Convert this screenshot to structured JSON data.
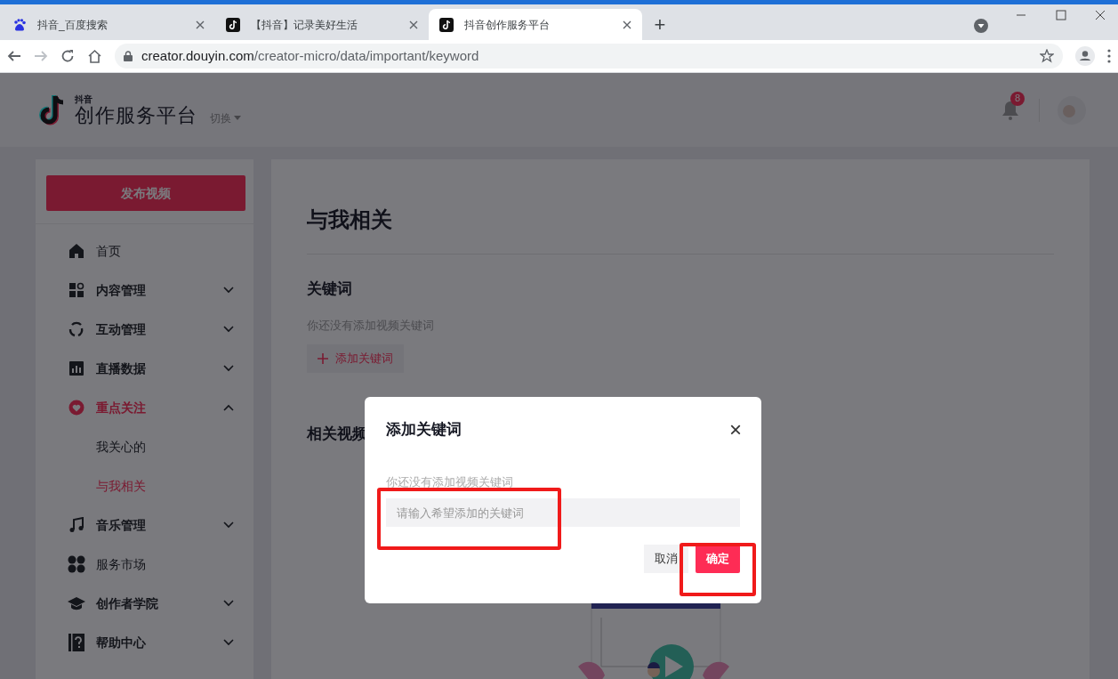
{
  "browser": {
    "tabs": [
      {
        "kind": "baidu",
        "title": "抖音_百度搜索",
        "selected": false
      },
      {
        "kind": "douyin",
        "title": "【抖音】记录美好生活",
        "selected": false
      },
      {
        "kind": "douyin",
        "title": "抖音创作服务平台",
        "selected": true
      }
    ],
    "new_tab": "+",
    "url_host": "creator.douyin.com",
    "url_path": "/creator-micro/data/important/keyword"
  },
  "header": {
    "logo_small": "抖音",
    "logo_title": "创作服务平台",
    "switch": "切换",
    "notification_count": "8"
  },
  "sidebar": {
    "publish_button": "发布视频",
    "items": [
      {
        "kind": "link",
        "label": "首页",
        "selected": false
      },
      {
        "kind": "group",
        "label": "内容管理",
        "selected": false,
        "expanded": false
      },
      {
        "kind": "group",
        "label": "互动管理",
        "selected": false,
        "expanded": false
      },
      {
        "kind": "group",
        "label": "直播数据",
        "selected": false,
        "expanded": false
      },
      {
        "kind": "group",
        "label": "重点关注",
        "selected": true,
        "expanded": true,
        "children": [
          {
            "label": "我关心的",
            "selected": false
          },
          {
            "label": "与我相关",
            "selected": true
          }
        ]
      },
      {
        "kind": "group",
        "label": "音乐管理",
        "selected": false,
        "expanded": false
      },
      {
        "kind": "link",
        "label": "服务市场",
        "selected": false
      },
      {
        "kind": "group",
        "label": "创作者学院",
        "selected": false,
        "expanded": false
      },
      {
        "kind": "group",
        "label": "帮助中心",
        "selected": false,
        "expanded": false
      }
    ]
  },
  "main": {
    "title": "与我相关",
    "keyword_heading": "关键词",
    "empty_text": "你还没有添加视频关键词",
    "add_button": "添加关键词",
    "related_heading": "相关视频"
  },
  "dialog": {
    "title": "添加关键词",
    "close": "×",
    "empty_text": "你还没有添加视频关键词",
    "placeholder": "请输入希望添加的关键词",
    "cancel": "取消",
    "confirm": "确定"
  }
}
